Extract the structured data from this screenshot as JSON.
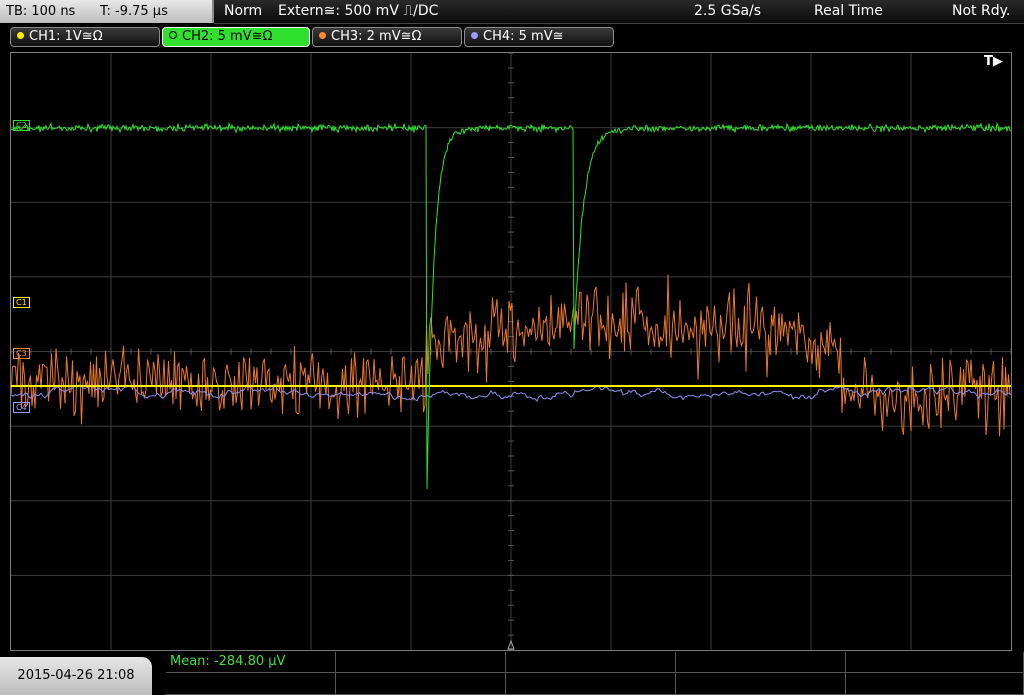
{
  "status_bar": {
    "timebase": "TB: 100 ns",
    "trigger_time": "T: -9.75 µs",
    "acq_mode": "Norm",
    "trigger_source": "Extern≅: 500 mV ⎍/DC",
    "sample_rate": "2.5 GSa/s",
    "acq_type": "Real Time",
    "trigger_state": "Not Rdy."
  },
  "channels": [
    {
      "label": "CH1: 1V≅Ω",
      "color": "#ffee00"
    },
    {
      "label": "CH2: 5 mV≅Ω",
      "color": "#2fe02f",
      "active": true
    },
    {
      "label": "CH3: 2 mV≅Ω",
      "color": "#ff8c33"
    },
    {
      "label": "CH4: 5 mV≅",
      "color": "#9a9aff"
    }
  ],
  "ref_markers": {
    "c1": "C1",
    "c2": "C2",
    "c3": "C3",
    "c4": "C4"
  },
  "trigger_marker": "T▶",
  "timestamp": "2015-04-26 21:08",
  "measurement": {
    "mean": "Mean: -284.80 µV"
  },
  "colors": {
    "ch1": "#ffee00",
    "ch2": "#2fe02f",
    "ch3": "#e8782a",
    "ch4": "#8d8df0",
    "grid": "#3c3c3c"
  }
}
